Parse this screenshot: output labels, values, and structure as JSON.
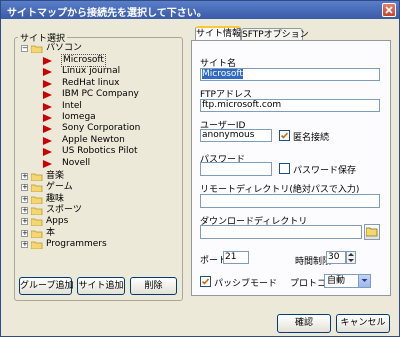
{
  "window": {
    "title": "サイトマップから接続先を選択して下さい。"
  },
  "tree_group": {
    "legend": "サイト選択",
    "root": {
      "label": "パソコン"
    },
    "sites": [
      "Microsoft",
      "Linux journal",
      "RedHat linux",
      "IBM PC Company",
      "Intel",
      "Iomega",
      "Sony Corporation",
      "Apple Newton",
      "US Robotics Pilot",
      "Novell"
    ],
    "folders": [
      "音楽",
      "ゲーム",
      "趣味",
      "スポーツ",
      "Apps",
      "本",
      "Programmers"
    ],
    "expand_symbol": "+",
    "collapse_symbol": "−"
  },
  "buttons": {
    "add_group": "グループ追加",
    "add_site": "サイト追加",
    "delete": "削除",
    "ok": "確認",
    "cancel": "キャンセル"
  },
  "tabs": [
    "サイト情報",
    "SFTPオプション"
  ],
  "form": {
    "site_name_label": "サイト名",
    "site_name_value": "Microsoft",
    "ftp_address_label": "FTPアドレス",
    "ftp_address_value": "ftp.microsoft.com",
    "user_id_label": "ユーザーID",
    "user_id_value": "anonymous",
    "anonymous_label": "匿名接続",
    "anonymous_checked": true,
    "password_label": "パスワード",
    "password_value": "",
    "save_password_label": "パスワード保存",
    "save_password_checked": false,
    "remote_dir_label": "リモートディレクトリ(絶対パスで入力)",
    "remote_dir_value": "",
    "download_dir_label": "ダウンロードディレクトリ",
    "download_dir_value": "",
    "port_label": "ポート",
    "port_value": "21",
    "timeout_label": "時間制限",
    "timeout_value": "30",
    "passive_label": "パッシブモード",
    "passive_checked": true,
    "protocol_label": "プロトコル",
    "protocol_value": "自動"
  },
  "colors": {
    "title_bar": "#3a5ba8",
    "site_arrow": "#cc0000",
    "selection": "#316ac5",
    "tab_highlight": "#ffc83c"
  }
}
